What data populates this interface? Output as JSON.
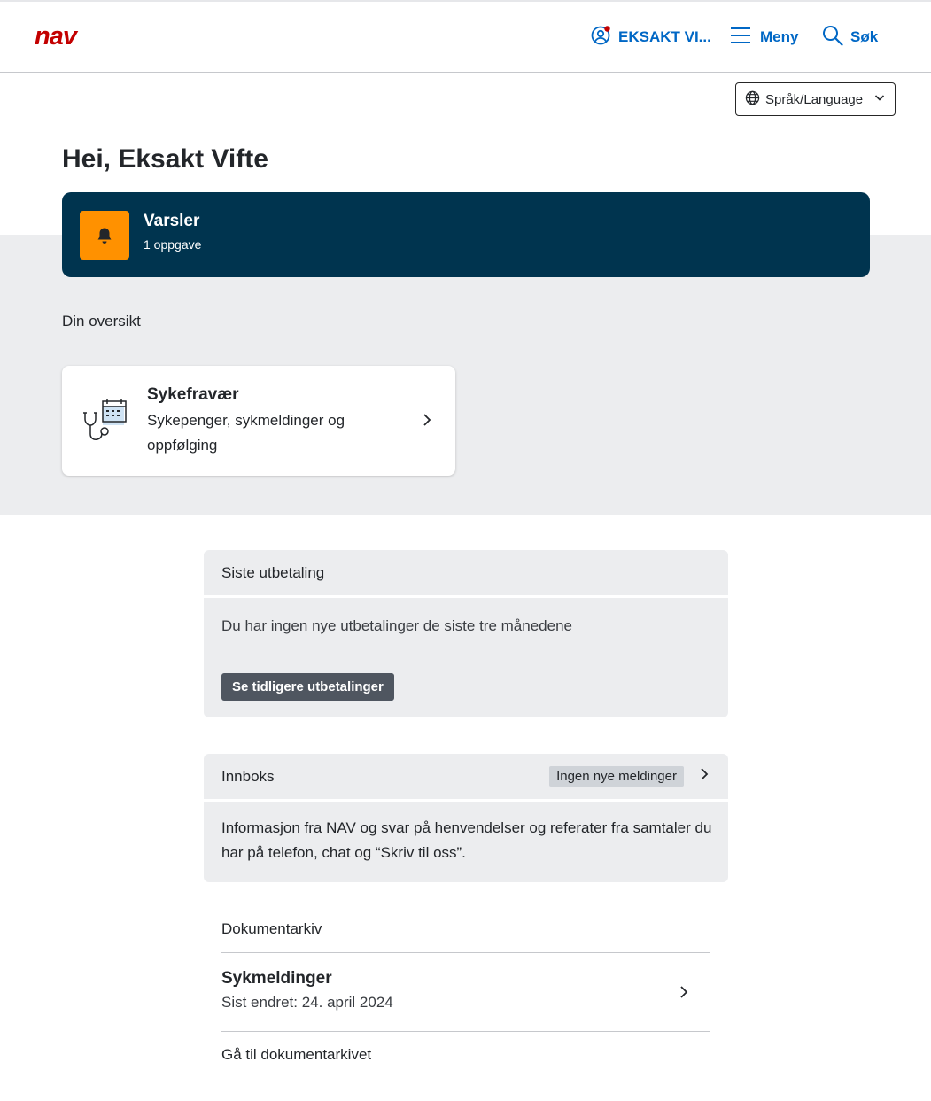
{
  "header": {
    "logo_text": "nav",
    "user_label": "EKSAKT VI...",
    "menu_label": "Meny",
    "search_label": "Søk"
  },
  "language": {
    "label": "Språk/Language"
  },
  "greeting": "Hei, Eksakt Vifte",
  "varsler": {
    "title": "Varsler",
    "subtitle": "1 oppgave"
  },
  "overview": {
    "label": "Din oversikt",
    "card": {
      "title": "Sykefravær",
      "description": "Sykepenger, sykmeldinger og oppfølging"
    }
  },
  "payments": {
    "title": "Siste utbetaling",
    "message": "Du har ingen nye utbetalinger de siste tre månedene",
    "button_label": "Se tidligere utbetalinger"
  },
  "inbox": {
    "title": "Innboks",
    "badge": "Ingen nye meldinger",
    "description": "Informasjon fra NAV og svar på henvendelser og referater fra samtaler du har på telefon, chat og “Skriv til oss”."
  },
  "documents": {
    "title": "Dokumentarkiv",
    "item_title": "Sykmeldinger",
    "item_subtitle": "Sist endret: 24. april 2024",
    "link_label": "Gå til dokumentarkivet"
  },
  "colors": {
    "brand_red": "#c30000",
    "link_blue": "#0067c5",
    "varsler_bg": "#00344f",
    "bell_bg": "#ff9100",
    "panel_bg": "#ecedef"
  }
}
